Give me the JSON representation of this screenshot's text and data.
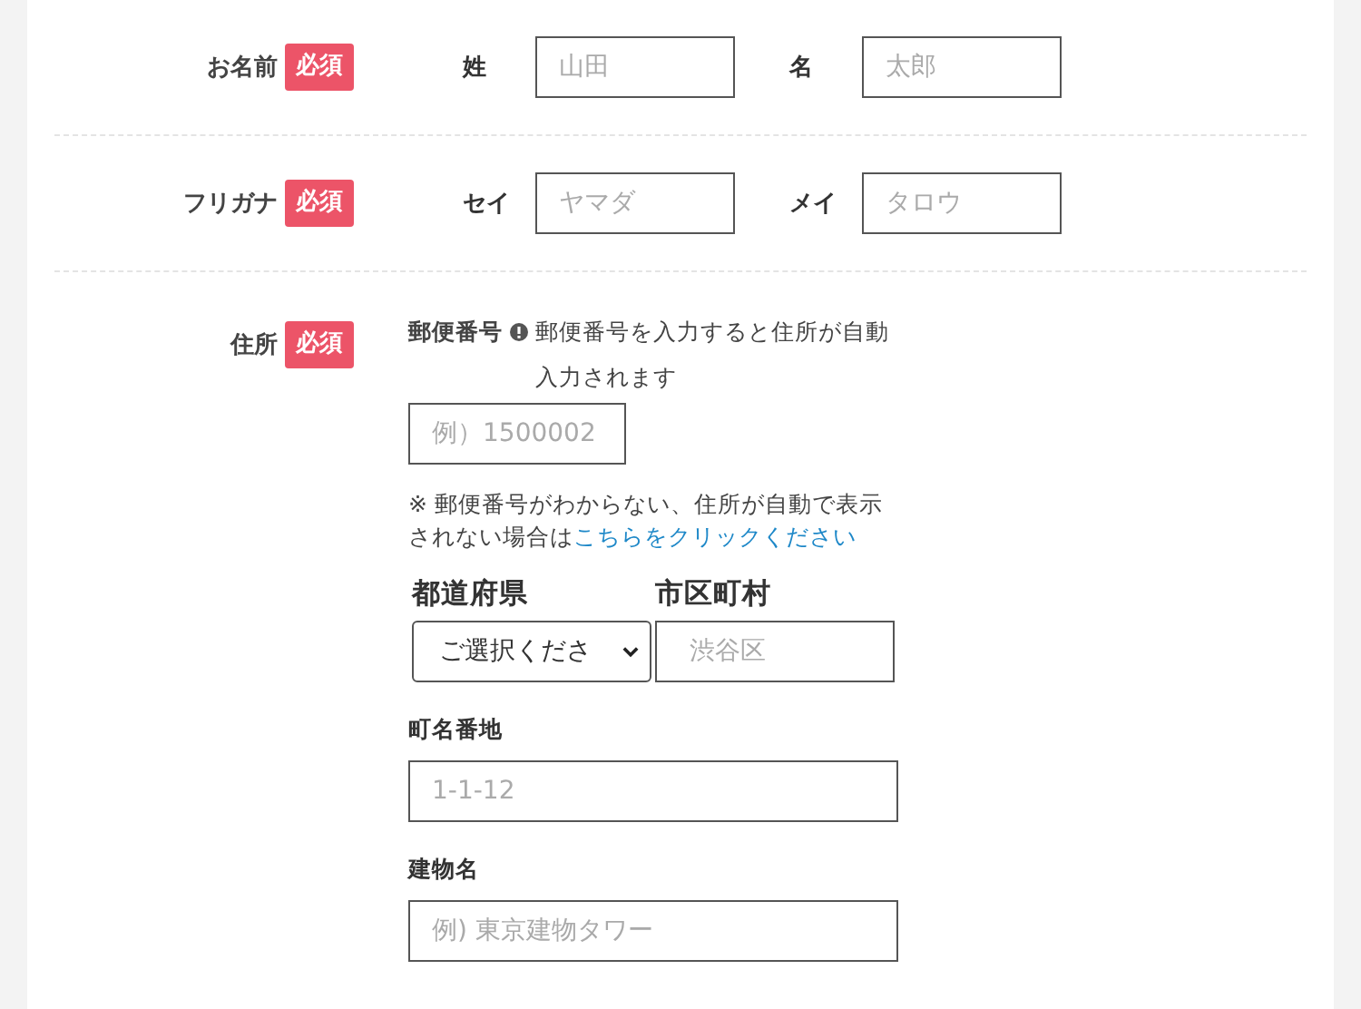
{
  "rows": [
    {
      "kind": "pair",
      "label": "お名前",
      "badge": "必須",
      "parts": [
        {
          "label": "姓",
          "placeholder": "山田"
        },
        {
          "label": "名",
          "placeholder": "太郎"
        }
      ]
    },
    {
      "kind": "pair",
      "label": "フリガナ",
      "badge": "必須",
      "parts": [
        {
          "label": "セイ",
          "placeholder": "ヤマダ"
        },
        {
          "label": "メイ",
          "placeholder": "タロウ"
        }
      ]
    },
    {
      "kind": "address",
      "label": "住所",
      "badge": "必須"
    }
  ],
  "address": {
    "zip_label": "郵便番号",
    "zip_hint": "郵便番号を入力すると住所が自動入力されます",
    "zip_placeholder": "例）1500002",
    "note": "※ 郵便番号がわからない、住所が自動で表示されない場合は",
    "note_link": "こちらをクリックください",
    "prefecture_label": "都道府県",
    "prefecture_value": "ご選択くださ",
    "city_label": "市区町村",
    "city_placeholder": "渋谷区",
    "street_label": "町名番地",
    "street_placeholder": "1-1-12",
    "building_label": "建物名",
    "building_placeholder": "例) 東京建物タワー"
  }
}
